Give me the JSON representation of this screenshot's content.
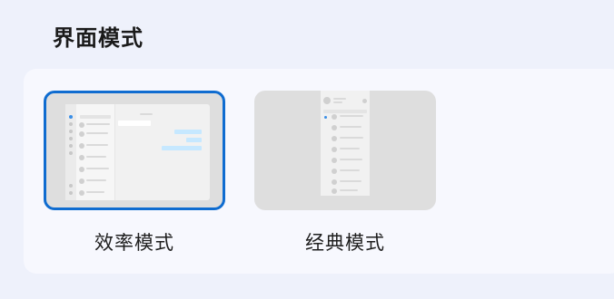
{
  "section": {
    "title": "界面模式"
  },
  "options": [
    {
      "label": "效率模式",
      "selected": true
    },
    {
      "label": "经典模式",
      "selected": false
    }
  ],
  "colors": {
    "accent": "#0f6cd0",
    "page_bg": "#eef1fb",
    "card_bg": "#f7f8fe"
  }
}
